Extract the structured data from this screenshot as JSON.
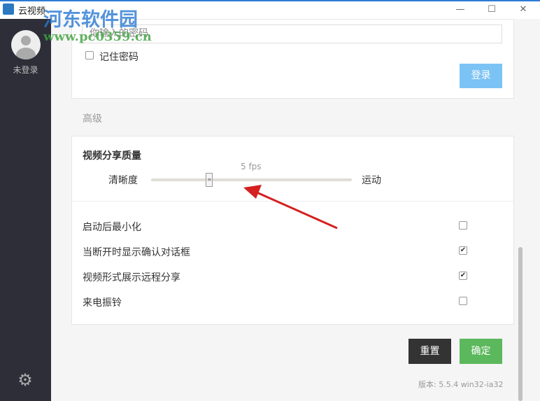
{
  "window": {
    "title": "云视频",
    "minimize": "—",
    "maximize": "☐",
    "close": "✕"
  },
  "sidebar": {
    "status": "未登录",
    "settings_icon": "gear-icon"
  },
  "login": {
    "password_placeholder": "你输入的密码",
    "remember_label": "记住密码",
    "remember_checked": false,
    "login_button": "登录"
  },
  "advanced": {
    "section_title": "高级",
    "quality": {
      "title": "视频分享质量",
      "fps_label": "5 fps",
      "left_label": "清晰度",
      "right_label": "运动",
      "slider_value": 0.29
    },
    "options": [
      {
        "label": "启动后最小化",
        "checked": false
      },
      {
        "label": "当断开时显示确认对话框",
        "checked": true
      },
      {
        "label": "视频形式展示远程分享",
        "checked": true
      },
      {
        "label": "来电振铃",
        "checked": false
      }
    ]
  },
  "footer": {
    "reset": "重置",
    "ok": "确定",
    "version": "版本: 5.5.4 win32-ia32"
  },
  "colors": {
    "primary": "#5cb85c",
    "login_disabled": "#7cc3f5",
    "dark_button": "#333333",
    "sidebar": "#2d2e38"
  },
  "watermark": {
    "name": "河东软件园",
    "url": "www.pc0359.cn"
  }
}
